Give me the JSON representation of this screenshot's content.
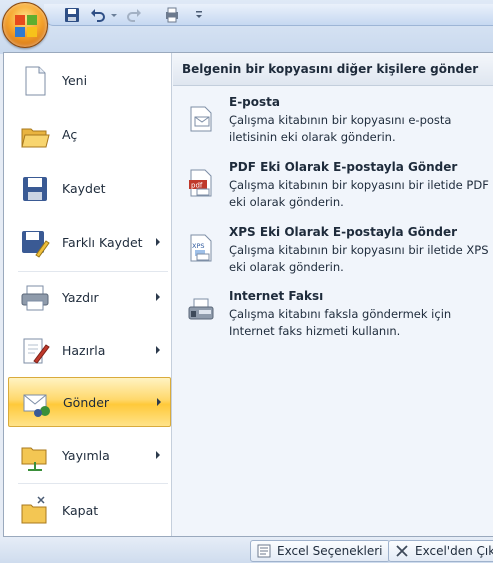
{
  "menu": {
    "items": [
      {
        "label": "Yeni",
        "icon": "new-document-icon",
        "submenu": false
      },
      {
        "label": "Aç",
        "icon": "open-folder-icon",
        "submenu": false
      },
      {
        "label": "Kaydet",
        "icon": "save-disk-icon",
        "submenu": false
      },
      {
        "label": "Farklı Kaydet",
        "icon": "save-as-icon",
        "submenu": true
      },
      {
        "label": "Yazdır",
        "icon": "printer-icon",
        "submenu": true
      },
      {
        "label": "Hazırla",
        "icon": "prepare-icon",
        "submenu": true
      },
      {
        "label": "Gönder",
        "icon": "send-icon",
        "submenu": true,
        "active": true
      },
      {
        "label": "Yayımla",
        "icon": "publish-icon",
        "submenu": true
      },
      {
        "label": "Kapat",
        "icon": "close-folder-icon",
        "submenu": false
      }
    ]
  },
  "panel": {
    "header": "Belgenin bir kopyasını diğer kişilere gönder",
    "options": [
      {
        "title": "E-posta",
        "desc": "Çalışma kitabının bir kopyasını e-posta iletisinin eki olarak gönderin.",
        "icon": "email-attachment-icon"
      },
      {
        "title": "PDF Eki Olarak E-postayla Gönder",
        "desc": "Çalışma kitabının bir kopyasını bir iletide PDF eki olarak gönderin.",
        "icon": "pdf-icon"
      },
      {
        "title": "XPS Eki Olarak E-postayla Gönder",
        "desc": "Çalışma kitabının bir kopyasını bir iletide XPS eki olarak gönderin.",
        "icon": "xps-icon"
      },
      {
        "title": "Internet Faksı",
        "desc": "Çalışma kitabını faksla göndermek için Internet faks hizmeti kullanın.",
        "icon": "fax-icon"
      }
    ]
  },
  "bottom": {
    "options_label": "Excel Seçenekleri",
    "exit_label": "Excel'den Çık"
  },
  "colors": {
    "active_highlight": "#ffd86b",
    "office_button": "#f6a52c"
  }
}
